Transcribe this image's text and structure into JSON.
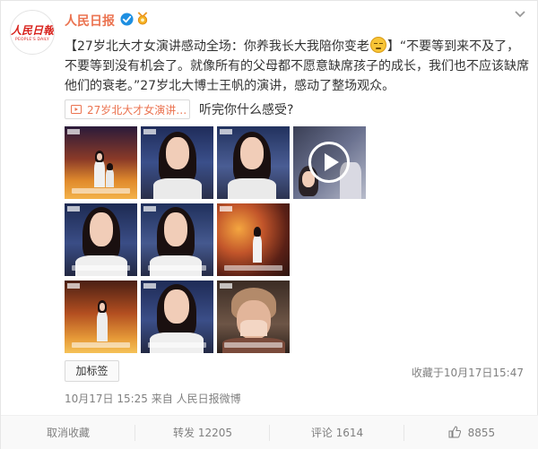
{
  "header": {
    "user_name": "人民日报",
    "avatar_logo_cn": "人民日報",
    "avatar_logo_en": "PEOPLE'S DAILY"
  },
  "post": {
    "text": "【27岁北大才女演讲感动全场：你养我长大我陪你变老",
    "text_after_emoji": "】“不要等到来不及了，不要等到没有机会了。就像所有的父母都不愿意缺席孩子的成长，我们也不应该缺席他们的衰老。”27岁北大博士王帆的演讲，感动了整场观众。",
    "emoji_name": "sad-face-emoji",
    "video_link_label": "27岁北大才女演讲…",
    "after_link_text": "听完你什么感受?"
  },
  "images": [
    {
      "name": "stage-wide-1"
    },
    {
      "name": "speaker-closeup-1"
    },
    {
      "name": "speaker-closeup-2"
    },
    {
      "name": "video-thumbnail"
    },
    {
      "name": "speaker-closeup-3"
    },
    {
      "name": "speaker-closeup-4"
    },
    {
      "name": "stage-autumn-1"
    },
    {
      "name": "stage-wide-2"
    },
    {
      "name": "speaker-smile"
    },
    {
      "name": "audience-crying"
    }
  ],
  "footer": {
    "tag_button": "加标签",
    "favorited_time": "收藏于10月17日15:47",
    "post_meta": "10月17日 15:25 来自 人民日报微博"
  },
  "actions": {
    "unfavorite": "取消收藏",
    "repost": "转发 12205",
    "comment": "评论 1614",
    "like": "8855"
  },
  "colors": {
    "accent": "#eb7350",
    "logo_red": "#d8221c",
    "verify_blue": "#1e8fe1",
    "meta_gray": "#808080"
  }
}
